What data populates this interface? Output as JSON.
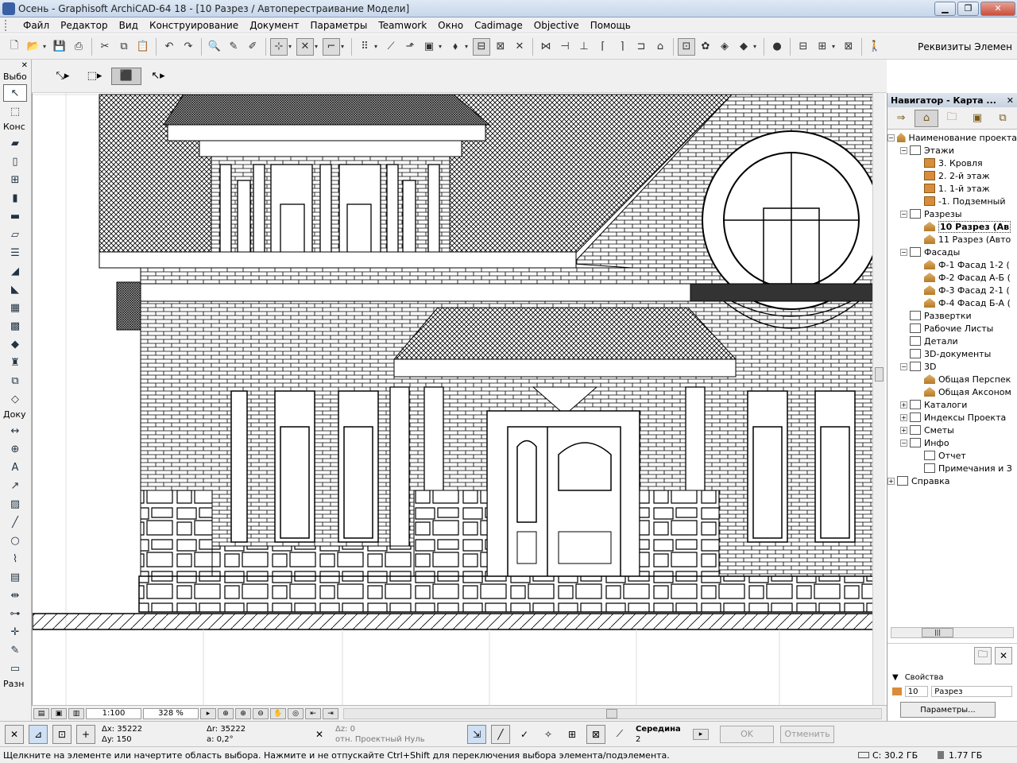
{
  "window": {
    "title": "Осень - Graphisoft ArchiCAD-64 18 - [10 Разрез / Автоперестраивание Модели]"
  },
  "menu": [
    "Файл",
    "Редактор",
    "Вид",
    "Конструирование",
    "Документ",
    "Параметры",
    "Teamwork",
    "Окно",
    "Cadimage",
    "Objective",
    "Помощь"
  ],
  "toolbar": {
    "rekvizity_label": "Реквизиты Элемен"
  },
  "toolbox": {
    "labels": {
      "select": "Выбо",
      "construct": "Конс",
      "document": "Доку",
      "other": "Разн"
    }
  },
  "navigator": {
    "title": "Навигатор - Карта ...",
    "tree": [
      {
        "label": "Наименование проекта",
        "level": 0,
        "icon": "house",
        "exp": "−"
      },
      {
        "label": "Этажи",
        "level": 1,
        "icon": "box",
        "exp": "−"
      },
      {
        "label": "3. Кровля",
        "level": 2,
        "icon": "floor"
      },
      {
        "label": "2. 2-й этаж",
        "level": 2,
        "icon": "floor"
      },
      {
        "label": "1. 1-й этаж",
        "level": 2,
        "icon": "floor"
      },
      {
        "label": "-1. Подземный",
        "level": 2,
        "icon": "floor"
      },
      {
        "label": "Разрезы",
        "level": 1,
        "icon": "box",
        "exp": "−"
      },
      {
        "label": "10 Разрез (Ав",
        "level": 2,
        "icon": "house",
        "selected": true
      },
      {
        "label": "11 Разрез (Авто",
        "level": 2,
        "icon": "house"
      },
      {
        "label": "Фасады",
        "level": 1,
        "icon": "box",
        "exp": "−"
      },
      {
        "label": "Ф-1 Фасад 1-2 (",
        "level": 2,
        "icon": "house"
      },
      {
        "label": "Ф-2 Фасад А-Б (",
        "level": 2,
        "icon": "house"
      },
      {
        "label": "Ф-3 Фасад 2-1 (",
        "level": 2,
        "icon": "house"
      },
      {
        "label": "Ф-4 Фасад Б-А (",
        "level": 2,
        "icon": "house"
      },
      {
        "label": "Развертки",
        "level": 1,
        "icon": "box"
      },
      {
        "label": "Рабочие Листы",
        "level": 1,
        "icon": "box"
      },
      {
        "label": "Детали",
        "level": 1,
        "icon": "box"
      },
      {
        "label": "3D-документы",
        "level": 1,
        "icon": "box"
      },
      {
        "label": "3D",
        "level": 1,
        "icon": "box",
        "exp": "−"
      },
      {
        "label": "Общая Перспек",
        "level": 2,
        "icon": "house"
      },
      {
        "label": "Общая Аксоном",
        "level": 2,
        "icon": "house"
      },
      {
        "label": "Каталоги",
        "level": 1,
        "icon": "box",
        "exp": "+"
      },
      {
        "label": "Индексы Проекта",
        "level": 1,
        "icon": "box",
        "exp": "+"
      },
      {
        "label": "Сметы",
        "level": 1,
        "icon": "box",
        "exp": "+"
      },
      {
        "label": "Инфо",
        "level": 1,
        "icon": "box",
        "exp": "−"
      },
      {
        "label": "Отчет",
        "level": 2,
        "icon": "box"
      },
      {
        "label": "Примечания и З",
        "level": 2,
        "icon": "box"
      },
      {
        "label": "Справка",
        "level": 0,
        "icon": "box",
        "exp": "+"
      }
    ],
    "properties": {
      "header": "Свойства",
      "id_value": "10",
      "name_value": "Разрез",
      "params_button": "Параметры..."
    }
  },
  "view": {
    "scale": "1:100",
    "zoom": "328 %"
  },
  "coords": {
    "dx": "Δx: 35222",
    "dy": "Δy: 150",
    "dr": "Δr: 35222",
    "angle": "a: 0,2°",
    "dz": "Δz: 0",
    "ref": "отн. Проектный Нуль",
    "snap": "Середина",
    "snap_val": "2",
    "ok": "OK",
    "cancel": "Отменить"
  },
  "status": {
    "message": "Щелкните на элементе или начертите область выбора. Нажмите и не отпускайте Ctrl+Shift для переключения выбора элемента/подэлемента.",
    "disk_c": "C: 30.2 ГБ",
    "memory": "1.77 ГБ"
  }
}
